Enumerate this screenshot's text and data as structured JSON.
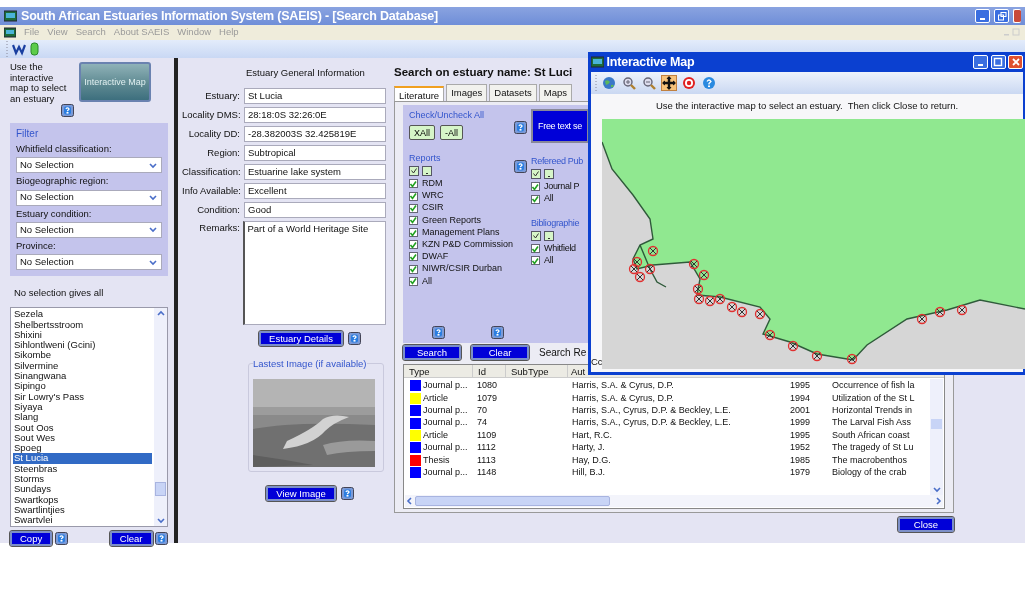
{
  "window": {
    "title": "South African Estuaries Information System  (SAEIS) - [Search Database]"
  },
  "menu": [
    "File",
    "View",
    "Search",
    "About SAEIS",
    "Window",
    "Help"
  ],
  "left_panel": {
    "map_hint": "Use the interactive map to select an estuary",
    "map_button": "Interactive Map",
    "filter": {
      "title": "Filter",
      "fields": [
        {
          "label": "Whitfield classification:",
          "value": "No Selection"
        },
        {
          "label": "Biogeographic region:",
          "value": "No Selection"
        },
        {
          "label": "Estuary condition:",
          "value": "No Selection"
        },
        {
          "label": "Province:",
          "value": "No Selection"
        }
      ]
    },
    "note": "No selection gives all",
    "estuaries": [
      {
        "name": "Sezela",
        "selected": false
      },
      {
        "name": "Shelbertsstroom",
        "selected": false
      },
      {
        "name": "Shixini",
        "selected": false
      },
      {
        "name": "Sihlontlweni (Gcini)",
        "selected": false
      },
      {
        "name": "Sikombe",
        "selected": false
      },
      {
        "name": "Silvermine",
        "selected": false
      },
      {
        "name": "Sinangwana",
        "selected": false
      },
      {
        "name": "Sipingo",
        "selected": false
      },
      {
        "name": "Sir Lowry's Pass",
        "selected": false
      },
      {
        "name": "Siyaya",
        "selected": false
      },
      {
        "name": "Slang",
        "selected": false
      },
      {
        "name": "Sout Oos",
        "selected": false
      },
      {
        "name": "Sout Wes",
        "selected": false
      },
      {
        "name": "Spoeg",
        "selected": false
      },
      {
        "name": "St Lucia",
        "selected": true
      },
      {
        "name": "Steenbras",
        "selected": false
      },
      {
        "name": "Storms",
        "selected": false
      },
      {
        "name": "Sundays",
        "selected": false
      },
      {
        "name": "Swartkops",
        "selected": false
      },
      {
        "name": "Swartlintjies",
        "selected": false
      },
      {
        "name": "Swartvlei",
        "selected": false
      }
    ],
    "buttons": [
      "Copy",
      "Clear"
    ]
  },
  "general_info": {
    "title": "Estuary General Information",
    "fields": [
      {
        "label": "Estuary:",
        "value": "St Lucia"
      },
      {
        "label": "Locality DMS:",
        "value": "28:18:0S  32:26:0E"
      },
      {
        "label": "Locality DD:",
        "value": "-28.382003S  32.425819E"
      },
      {
        "label": "Region:",
        "value": "Subtropical"
      },
      {
        "label": "Classification:",
        "value": "Estuarine lake system"
      },
      {
        "label": "Info Available:",
        "value": "Excellent"
      },
      {
        "label": "Condition:",
        "value": "Good"
      }
    ],
    "remarks": {
      "label": "Remarks:",
      "value": "Part of a World Heritage Site"
    },
    "details_button": "Estuary Details",
    "image_title": "Lastest Image (if available)",
    "view_button": "View Image"
  },
  "search": {
    "title": "Search on estuary name: St Luci",
    "tabs": [
      {
        "label": "Literature",
        "selected": true
      },
      {
        "label": "Images",
        "selected": false
      },
      {
        "label": "Datasets",
        "selected": false
      },
      {
        "label": "Maps",
        "selected": false
      }
    ],
    "check_all": {
      "title": "Check/Uncheck All",
      "buttons": [
        "XAll",
        "-All"
      ]
    },
    "free_text_button": "Free text se",
    "groups": [
      {
        "title": "Reports",
        "items": [
          {
            "label": "RDM",
            "checked": true
          },
          {
            "label": "WRC",
            "checked": true
          },
          {
            "label": "CSIR",
            "checked": true
          },
          {
            "label": "Green Reports",
            "checked": true
          },
          {
            "label": "Management Plans",
            "checked": true
          },
          {
            "label": "KZN P&D Commission",
            "checked": true
          },
          {
            "label": "DWAF",
            "checked": true
          },
          {
            "label": "NIWR/CSIR Durban",
            "checked": true
          },
          {
            "label": "All",
            "checked": true
          }
        ]
      },
      {
        "title": "Refereed Pub",
        "items": [
          {
            "label": "Journal P",
            "checked": true
          },
          {
            "label": "All",
            "checked": true
          }
        ]
      },
      {
        "title": "Bibliographie",
        "items": [
          {
            "label": "Whitfield",
            "checked": true
          },
          {
            "label": "All",
            "checked": true
          }
        ]
      }
    ],
    "buttons": [
      "Search",
      "Clear"
    ],
    "results_label": "Search Re",
    "table": {
      "columns": [
        "Type",
        "Id",
        "SubType",
        "Aut"
      ],
      "rows": [
        {
          "type": "Journal p...",
          "color": "#0000ff",
          "id": "1080",
          "author": "Harris, S.A. & Cyrus, D.P.",
          "year": "1995",
          "title": "Occurrence of fish la"
        },
        {
          "type": "Article",
          "color": "#ffff00",
          "id": "1079",
          "author": "Harris, S.A. & Cyrus, D.P.",
          "year": "1994",
          "title": "Utilization of the St L"
        },
        {
          "type": "Journal p...",
          "color": "#0000ff",
          "id": "70",
          "author": "Harris, S.A., Cyrus, D.P. & Beckley, L.E.",
          "year": "2001",
          "title": "Horizontal Trends in"
        },
        {
          "type": "Journal p...",
          "color": "#0000ff",
          "id": "74",
          "author": "Harris, S.A., Cyrus, D.P. & Beckley, L.E.",
          "year": "1999",
          "title": "The Larval Fish Ass"
        },
        {
          "type": "Article",
          "color": "#ffff00",
          "id": "1109",
          "author": "Hart, R.C.",
          "year": "1995",
          "title": "South African coast"
        },
        {
          "type": "Journal p...",
          "color": "#0000ff",
          "id": "1112",
          "author": "Harty, J.",
          "year": "1952",
          "title": "The tragedy of St Lu"
        },
        {
          "type": "Thesis",
          "color": "#ff0000",
          "id": "1113",
          "author": "Hay, D.G.",
          "year": "1985",
          "title": "The macrobenthos"
        },
        {
          "type": "Journal p...",
          "color": "#0000ff",
          "id": "1148",
          "author": "Hill, B.J.",
          "year": "1979",
          "title": "Biology of the crab"
        }
      ]
    },
    "close_button": "Close"
  },
  "map_window": {
    "title": "Interactive Map",
    "tools": [
      {
        "kind": "globe",
        "selected": false
      },
      {
        "kind": "zoom_in",
        "selected": false
      },
      {
        "kind": "zoom_out",
        "selected": false
      },
      {
        "kind": "pan",
        "selected": true
      },
      {
        "kind": "target",
        "selected": false
      },
      {
        "kind": "help",
        "selected": false
      }
    ],
    "instruction": "Use the interactive map to select an estuary.  Then click Close to return.",
    "footer": "Cc"
  }
}
